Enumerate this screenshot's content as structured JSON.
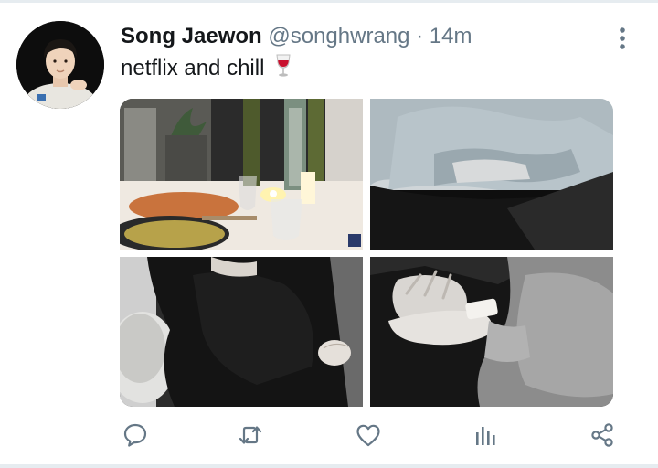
{
  "tweet": {
    "author_name": "Song Jaewon",
    "handle": "@songhwrang",
    "separator": "·",
    "time": "14m",
    "text": "netflix and chill",
    "emoji": "wine-glass-emoji"
  },
  "media": [
    {
      "name": "photo-dinner-table",
      "icon": "photo"
    },
    {
      "name": "photo-holding-hands-light",
      "icon": "photo"
    },
    {
      "name": "photo-hug-dark",
      "icon": "photo"
    },
    {
      "name": "photo-hands-closeup",
      "icon": "photo"
    }
  ],
  "actions": [
    {
      "name": "reply-button",
      "icon": "reply-icon"
    },
    {
      "name": "retweet-button",
      "icon": "retweet-icon"
    },
    {
      "name": "like-button",
      "icon": "heart-icon"
    },
    {
      "name": "analytics-button",
      "icon": "analytics-icon"
    },
    {
      "name": "share-button",
      "icon": "share-icon"
    }
  ],
  "colors": {
    "text": "#14171a",
    "secondary": "#657786",
    "divider": "#e6ecf0",
    "accent": "#1da1f2"
  }
}
